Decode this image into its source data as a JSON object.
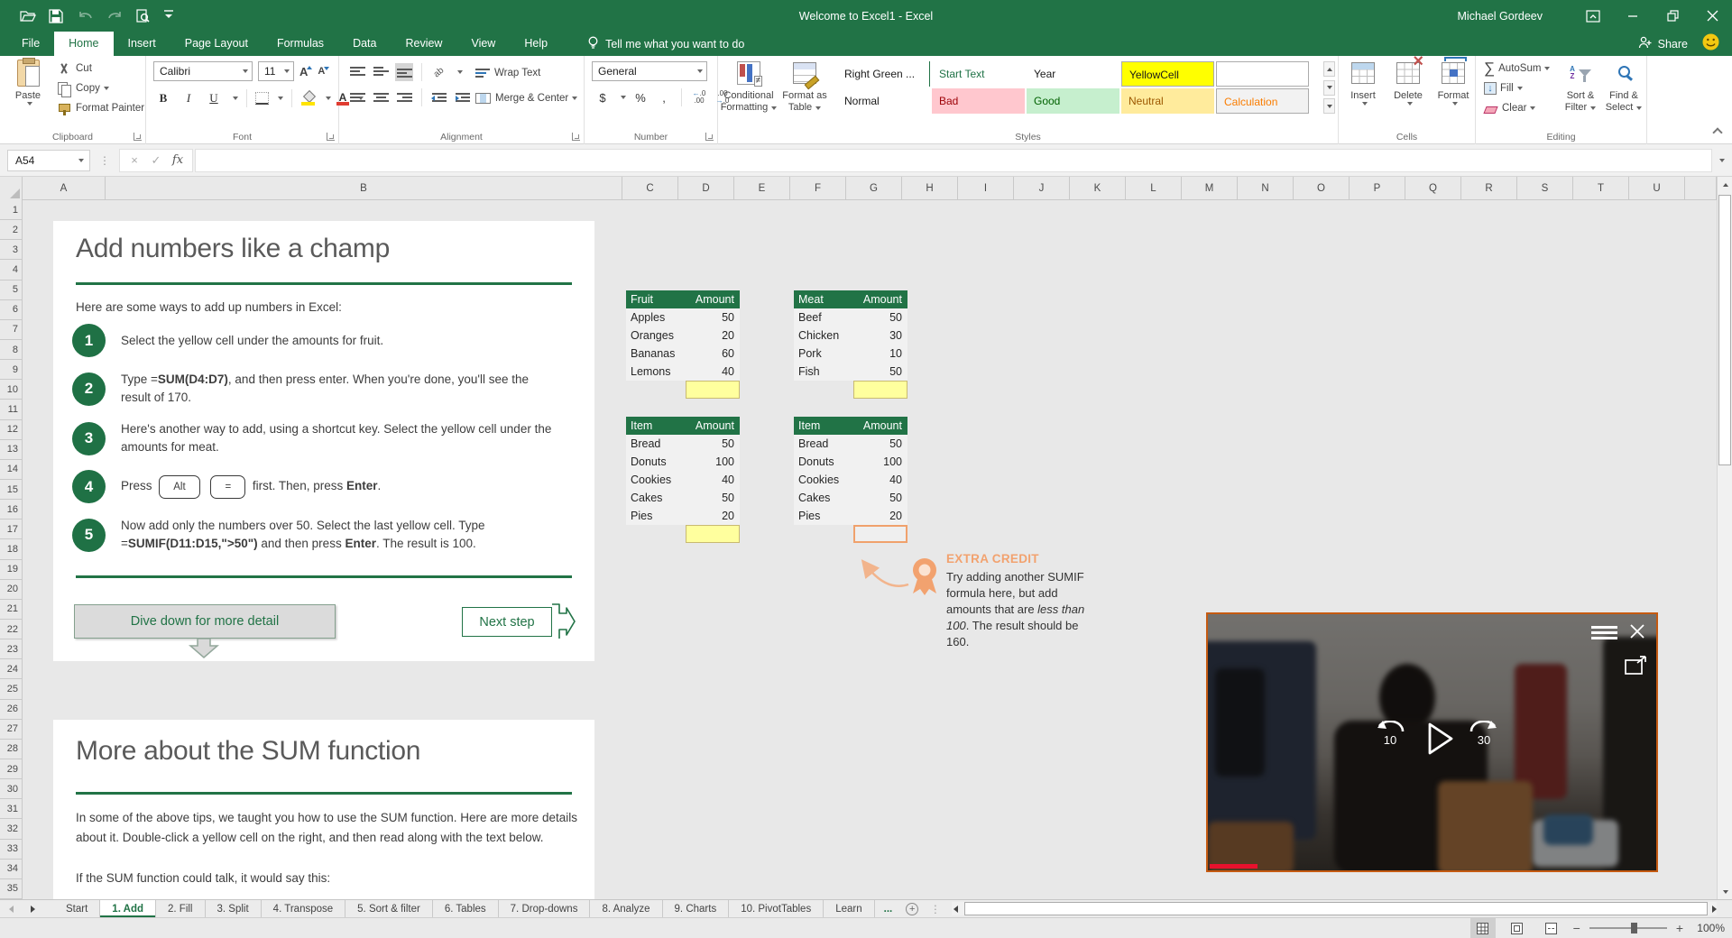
{
  "colors": {
    "excel_green": "#217346",
    "yellow_cell": "#FFFF9E",
    "orange_cell_border": "#F0A16C",
    "extra_credit_accent": "#F2A26F",
    "video_border": "#C55A11",
    "progress_red": "#E8112D",
    "bad_bg": "#FFC7CE",
    "bad_fg": "#9C0006",
    "good_bg": "#C6EFCE",
    "good_fg": "#006100",
    "neutral_bg": "#FFEB9C",
    "neutral_fg": "#9C5700",
    "calculation_fg": "#FA7D00"
  },
  "title_bar": {
    "title": "Welcome to Excel1  -  Excel",
    "user_name": "Michael Gordeev",
    "share_label": "Share"
  },
  "ribbon": {
    "tabs": [
      "File",
      "Home",
      "Insert",
      "Page Layout",
      "Formulas",
      "Data",
      "Review",
      "View",
      "Help"
    ],
    "active_tab": "Home",
    "tell_me": "Tell me what you want to do",
    "clipboard": {
      "label": "Clipboard",
      "paste": "Paste",
      "cut": "Cut",
      "copy": "Copy",
      "format_painter": "Format Painter"
    },
    "font": {
      "label": "Font",
      "family": "Calibri",
      "size": "11",
      "bold": "B",
      "italic": "I",
      "underline": "U"
    },
    "alignment": {
      "label": "Alignment",
      "wrap_text": "Wrap Text",
      "merge_center": "Merge & Center"
    },
    "number": {
      "label": "Number",
      "format": "General",
      "currency": "$",
      "percent": "%",
      "comma": ",",
      "inc_dec": "←.0 .00",
      "dec_dec": ".00 →.0"
    },
    "styles": {
      "label": "Styles",
      "conditional_line1": "Conditional",
      "conditional_line2": "Formatting",
      "format_table_line1": "Format as",
      "format_table_line2": "Table",
      "gallery": [
        {
          "label": "Right Green ...",
          "bg": "#FFFFFF",
          "fg": "#1a1a1a",
          "bd": "0"
        },
        {
          "label": "Start Text",
          "bg": "#FFFFFF",
          "fg": "#1F7246",
          "bd": "0"
        },
        {
          "label": "Year",
          "bg": "#FFFFFF",
          "fg": "#1a1a1a",
          "bd": "0"
        },
        {
          "label": "YellowCell",
          "bg": "#FFFF00",
          "fg": "#1a1a1a",
          "bd": "1"
        },
        {
          "label": "",
          "bg": "#FFFFFF",
          "fg": "#1a1a1a",
          "bd": "1"
        },
        {
          "label": "Normal",
          "bg": "#FFFFFF",
          "fg": "#1a1a1a",
          "bd": "0"
        },
        {
          "label": "Bad",
          "bg": "#FFC7CE",
          "fg": "#9C0006",
          "bd": "0"
        },
        {
          "label": "Good",
          "bg": "#C6EFCE",
          "fg": "#006100",
          "bd": "0"
        },
        {
          "label": "Neutral",
          "bg": "#FFEB9C",
          "fg": "#9C5700",
          "bd": "0"
        },
        {
          "label": "Calculation",
          "bg": "#F2F2F2",
          "fg": "#FA7D00",
          "bd": "1"
        }
      ]
    },
    "cells": {
      "label": "Cells",
      "buttons": [
        "Insert",
        "Delete",
        "Format"
      ]
    },
    "editing": {
      "label": "Editing",
      "autosum": "AutoSum",
      "fill": "Fill",
      "clear": "Clear",
      "sort_line1": "Sort &",
      "sort_line2": "Filter",
      "find_line1": "Find &",
      "find_line2": "Select"
    }
  },
  "formula_bar": {
    "name_box": "A54",
    "fx": "fx"
  },
  "grid": {
    "columns": [
      "A",
      "B",
      "C",
      "D",
      "E",
      "F",
      "G",
      "H",
      "I",
      "J",
      "K",
      "L",
      "M",
      "N",
      "O",
      "P",
      "Q",
      "R",
      "S",
      "T",
      "U"
    ],
    "row_start": 1,
    "row_end": 35
  },
  "content": {
    "section1": {
      "title": "Add numbers like a champ",
      "intro": "Here are some ways to add up numbers in Excel:",
      "steps": [
        {
          "num": "1",
          "parts": [
            {
              "t": "Select the yellow cell under the amounts for fruit."
            }
          ]
        },
        {
          "num": "2",
          "parts": [
            {
              "t": "Type ="
            },
            {
              "t": "SUM(D4:D7)",
              "b": 1
            },
            {
              "t": ", and then press enter. When you're done, you'll see the result of 170."
            }
          ]
        },
        {
          "num": "3",
          "parts": [
            {
              "t": "Here's another way to add, using a shortcut key. Select the yellow cell under the amounts for meat."
            }
          ]
        },
        {
          "num": "4",
          "parts": [
            {
              "t": "Press "
            },
            {
              "t": "Alt",
              "k": 1
            },
            {
              "t": " "
            },
            {
              "t": "=",
              "k": 1
            },
            {
              "t": " first. Then, press "
            },
            {
              "t": "Enter",
              "b": 1
            },
            {
              "t": "."
            }
          ]
        },
        {
          "num": "5",
          "parts": [
            {
              "t": "Now add only the numbers over 50. Select the last yellow cell. Type ="
            },
            {
              "t": "SUMIF(D11:D15,\">50\")",
              "b": 1
            },
            {
              "t": " and then press "
            },
            {
              "t": "Enter",
              "b": 1
            },
            {
              "t": ". The result is 100."
            }
          ]
        }
      ],
      "dive_button": "Dive down for more detail",
      "next_button": "Next step"
    },
    "tables": [
      {
        "id": "fruit",
        "headers": [
          "Fruit",
          "Amount"
        ],
        "rows": [
          [
            "Apples",
            "50"
          ],
          [
            "Oranges",
            "20"
          ],
          [
            "Bananas",
            "60"
          ],
          [
            "Lemons",
            "40"
          ]
        ],
        "sum_style": "yellow"
      },
      {
        "id": "meat",
        "headers": [
          "Meat",
          "Amount"
        ],
        "rows": [
          [
            "Beef",
            "50"
          ],
          [
            "Chicken",
            "30"
          ],
          [
            "Pork",
            "10"
          ],
          [
            "Fish",
            "50"
          ]
        ],
        "sum_style": "yellow"
      },
      {
        "id": "item-left",
        "headers": [
          "Item",
          "Amount"
        ],
        "rows": [
          [
            "Bread",
            "50"
          ],
          [
            "Donuts",
            "100"
          ],
          [
            "Cookies",
            "40"
          ],
          [
            "Cakes",
            "50"
          ],
          [
            "Pies",
            "20"
          ]
        ],
        "sum_style": "yellow"
      },
      {
        "id": "item-right",
        "headers": [
          "Item",
          "Amount"
        ],
        "rows": [
          [
            "Bread",
            "50"
          ],
          [
            "Donuts",
            "100"
          ],
          [
            "Cookies",
            "40"
          ],
          [
            "Cakes",
            "50"
          ],
          [
            "Pies",
            "20"
          ]
        ],
        "sum_style": "orange"
      }
    ],
    "extra_credit": {
      "title": "EXTRA CREDIT",
      "parts": [
        {
          "t": "Try adding another SUMIF formula here, but add amounts that are "
        },
        {
          "t": "less than 100",
          "i": 1
        },
        {
          "t": ". The result should be 160."
        }
      ]
    },
    "section2": {
      "title": "More about the SUM function",
      "para1": "In some of the above tips, we taught you how to use the SUM function. Here are more details about it. Double-click a yellow cell on the right, and then read along with the text below.",
      "para2": "If the SUM function could talk, it would say this:"
    }
  },
  "video_player": {
    "skip_back": "10",
    "skip_forward": "30"
  },
  "sheet_tabs": {
    "tabs": [
      "Start",
      "1. Add",
      "2. Fill",
      "3. Split",
      "4. Transpose",
      "5. Sort & filter",
      "6. Tables",
      "7. Drop-downs",
      "8. Analyze",
      "9. Charts",
      "10. PivotTables",
      "Learn"
    ],
    "active": "1. Add",
    "overflow": "..."
  },
  "status_bar": {
    "zoom_level": "100%"
  }
}
